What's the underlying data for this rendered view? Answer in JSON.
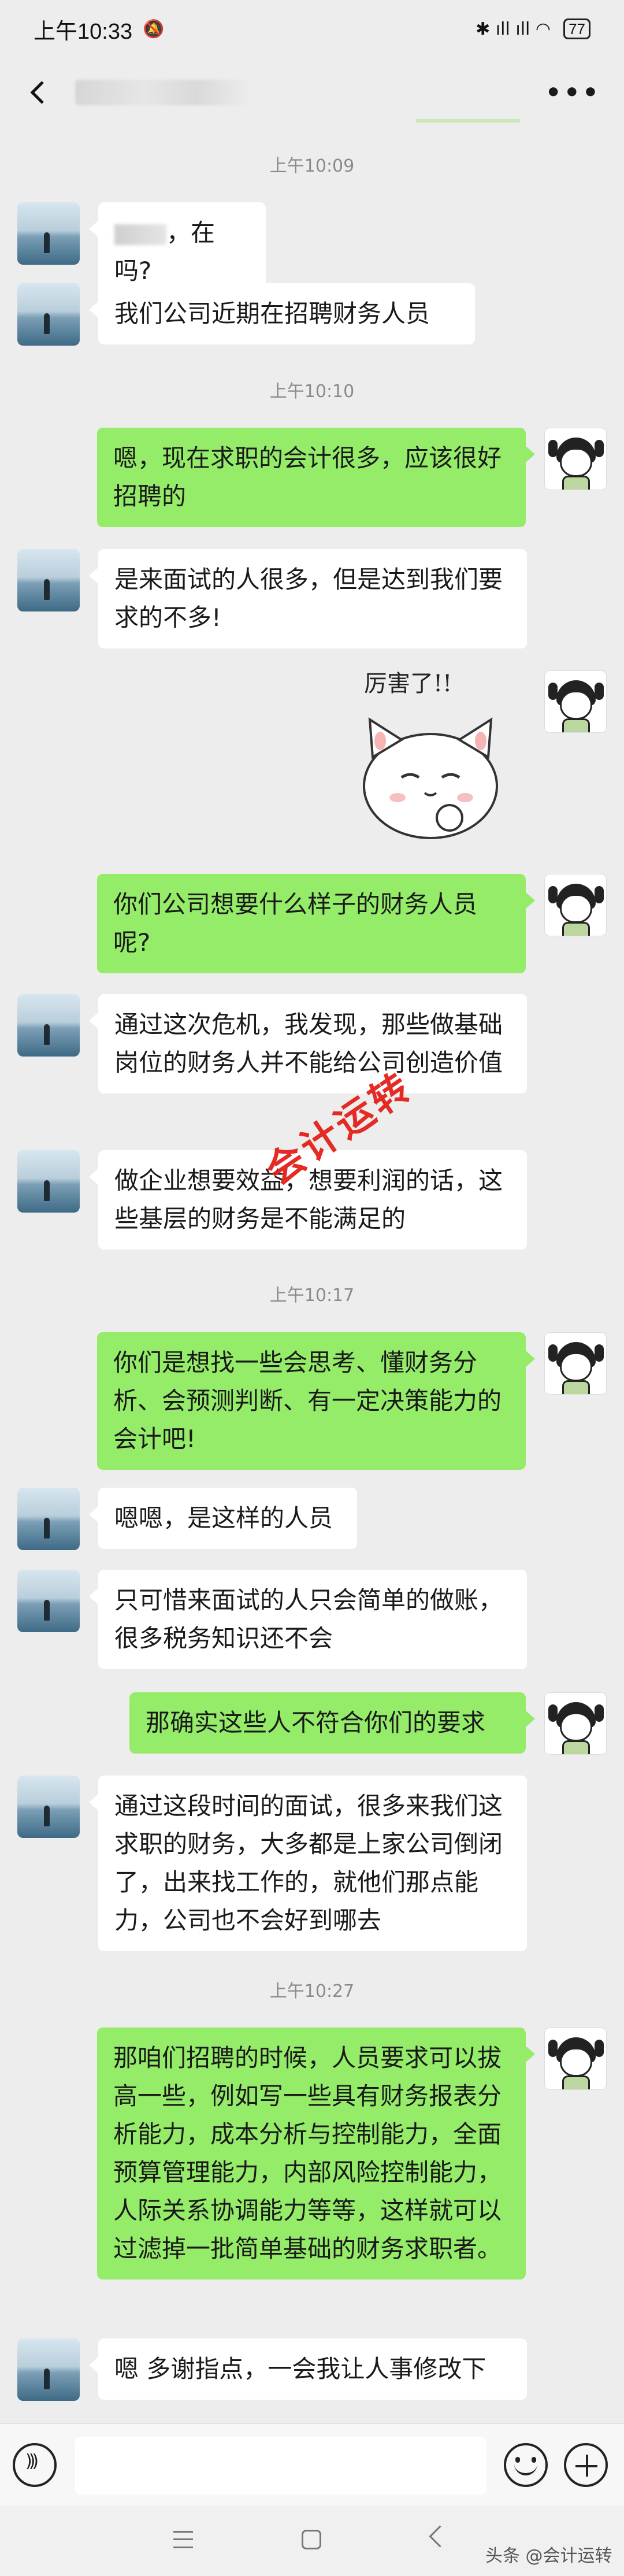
{
  "status_bar": {
    "time": "上午10:33",
    "bell": "🔕",
    "icons": "✱ ıll ıll ◠",
    "battery": "77"
  },
  "header": {
    "more": "•••"
  },
  "timestamps": [
    "上午10:09",
    "上午10:10",
    "上午10:17",
    "上午10:27"
  ],
  "messages": {
    "m1": "，在吗?",
    "m2": "我们公司近期在招聘财务人员",
    "m3": "嗯，现在求职的会计很多，应该很好招聘的",
    "m4": "是来面试的人很多，但是达到我们要求的不多!",
    "m5": "你们公司想要什么样子的财务人员呢?",
    "m6": "通过这次危机，我发现，那些做基础岗位的财务人并不能给公司创造价值",
    "m7": "做企业想要效益，想要利润的话，这些基层的财务是不能满足的",
    "m8": "你们是想找一些会思考、懂财务分析、会预测判断、有一定决策能力的会计吧!",
    "m9": "嗯嗯，是这样的人员",
    "m10": "只可惜来面试的人只会简单的做账，很多税务知识还不会",
    "m11": "那确实这些人不符合你们的要求",
    "m12": "通过这段时间的面试，很多来我们这求职的财务，大多都是上家公司倒闭了，出来找工作的，就他们那点能力，公司也不会好到哪去",
    "m13": "那咱们招聘的时候，人员要求可以拔高一些，例如写一些具有财务报表分析能力，成本分析与控制能力，全面预算管理能力，内部风险控制能力，人际关系协调能力等等，这样就可以过滤掉一批简单基础的财务求职者。",
    "m14": "嗯 多谢指点，一会我让人事修改下"
  },
  "sticker_text": "厉害了!!",
  "watermark": "会计运转",
  "credit": "头条 @会计运转"
}
